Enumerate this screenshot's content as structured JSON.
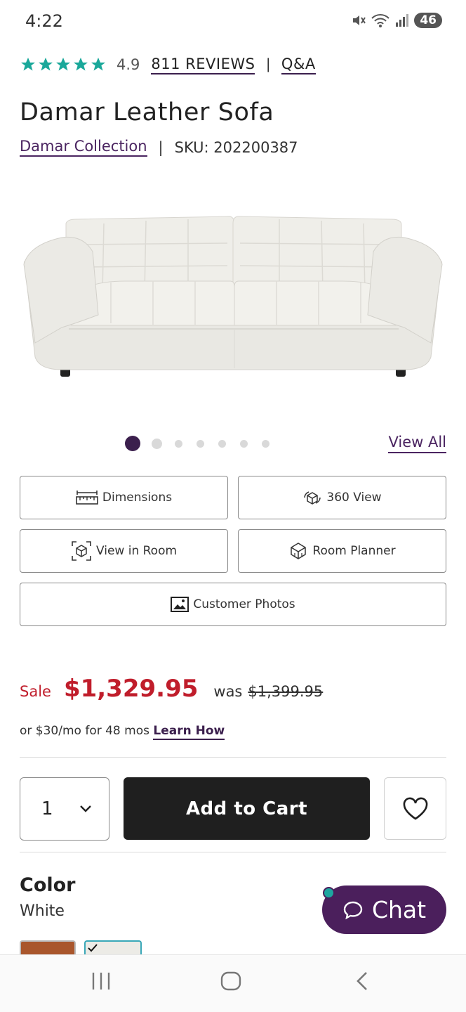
{
  "status_bar": {
    "time": "4:22",
    "battery": "46"
  },
  "rating": {
    "value": "4.9",
    "stars": 5,
    "reviews_label": "811 REVIEWS",
    "qa_label": "Q&A",
    "star_color": "#1aa89a"
  },
  "product": {
    "title": "Damar Leather Sofa",
    "collection": "Damar Collection",
    "sku": "SKU: 202200387",
    "separator": "|"
  },
  "gallery": {
    "view_all_label": "View All",
    "dot_count": 7,
    "active_index": 0
  },
  "options": {
    "dimensions": "Dimensions",
    "view_360": "360 View",
    "view_in_room": "View in Room",
    "room_planner": "Room Planner",
    "customer_photos": "Customer Photos"
  },
  "pricing": {
    "sale_label": "Sale",
    "sale_price": "$1,329.95",
    "was_label": "was",
    "was_price": "$1,399.95",
    "financing_text": "or $30/mo for 48 mos",
    "learn_how": "Learn How",
    "sale_color": "#c01d2b"
  },
  "cart": {
    "quantity": "1",
    "add_to_cart_label": "Add to Cart"
  },
  "color": {
    "heading": "Color",
    "selected": "White",
    "swatches": [
      "#a9562c",
      "#ecebe6"
    ]
  },
  "chat": {
    "label": "Chat",
    "brand_color": "#4b1f5c"
  }
}
